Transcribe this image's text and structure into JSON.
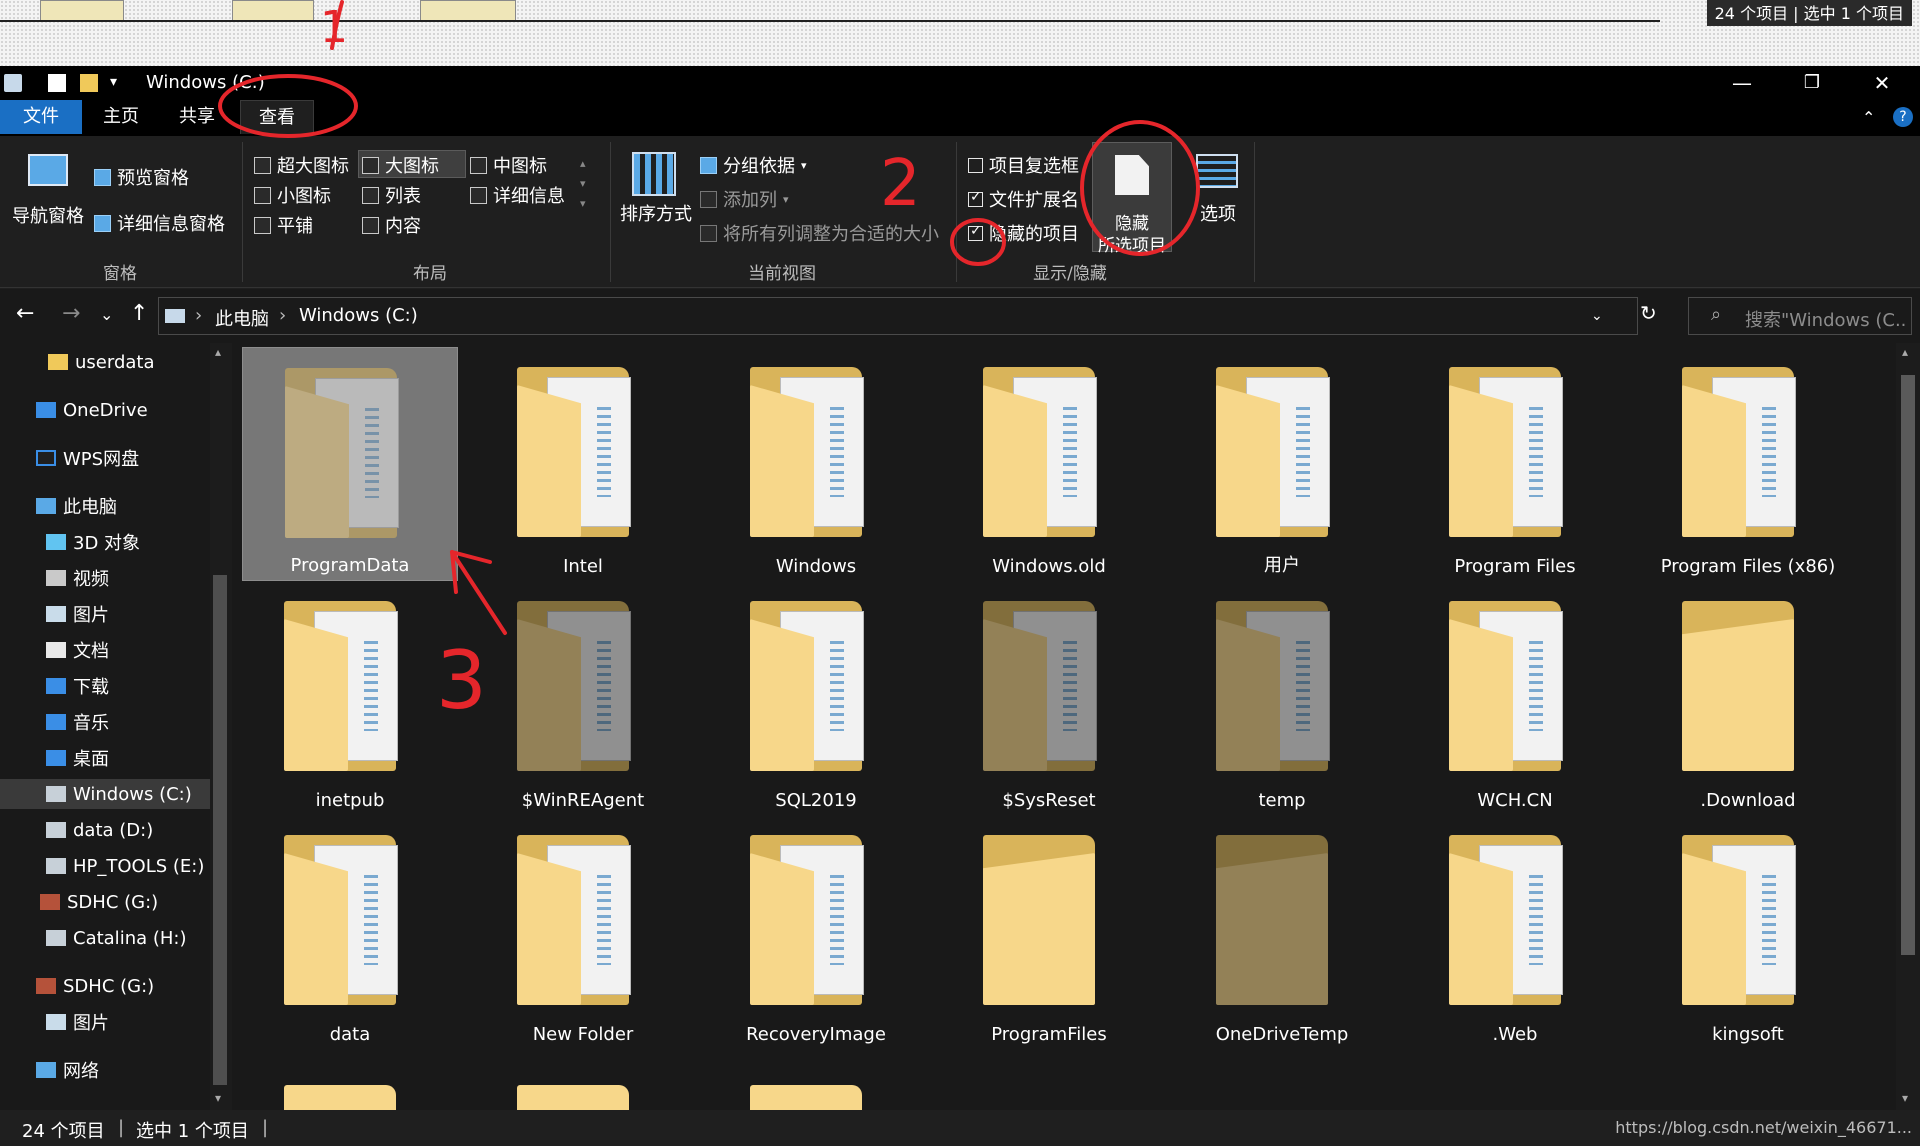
{
  "topstrip": {
    "status_ghost": "24 个项目 | 选中 1 个项目"
  },
  "titlebar": {
    "title": "Windows (C:)",
    "minimize": "—",
    "restore": "❐",
    "close": "✕"
  },
  "tabs": [
    {
      "label": "文件"
    },
    {
      "label": "主页"
    },
    {
      "label": "共享"
    },
    {
      "label": "查看"
    }
  ],
  "ribbon": {
    "pane": {
      "nav_pane": "导航窗格",
      "preview_pane": "预览窗格",
      "details_pane": "详细信息窗格",
      "group_label": "窗格"
    },
    "layout": {
      "extra_large": "超大图标",
      "large": "大图标",
      "medium": "中图标",
      "small": "小图标",
      "list": "列表",
      "details": "详细信息",
      "tiles": "平铺",
      "content": "内容",
      "group_label": "布局"
    },
    "current_view": {
      "sort_by": "排序方式",
      "group_by": "分组依据",
      "add_column": "添加列",
      "size_all_columns": "将所有列调整为合适的大小",
      "group_label": "当前视图"
    },
    "show_hide": {
      "item_checkboxes": "项目复选框",
      "item_checkboxes_checked": false,
      "file_extensions": "文件扩展名",
      "file_extensions_checked": true,
      "hidden_items": "隐藏的项目",
      "hidden_items_checked": true,
      "hide_selected_line1": "隐藏",
      "hide_selected_line2": "所选项目",
      "group_label": "显示/隐藏"
    },
    "options": "选项"
  },
  "address": {
    "crumbs": [
      "此电脑",
      "Windows (C:)"
    ],
    "search_placeholder": "搜索\"Windows (C..."
  },
  "navpane": {
    "items": [
      {
        "label": "userdata",
        "icon": "folder-icon"
      },
      {
        "label": "OneDrive",
        "icon": "cloud-icon"
      },
      {
        "label": "WPS网盘",
        "icon": "cloud-outline-icon"
      },
      {
        "label": "此电脑",
        "icon": "computer-icon"
      },
      {
        "label": "3D 对象",
        "icon": "cube-icon"
      },
      {
        "label": "视频",
        "icon": "video-icon"
      },
      {
        "label": "图片",
        "icon": "picture-icon"
      },
      {
        "label": "文档",
        "icon": "document-icon"
      },
      {
        "label": "下载",
        "icon": "download-icon"
      },
      {
        "label": "音乐",
        "icon": "music-icon"
      },
      {
        "label": "桌面",
        "icon": "desktop-icon"
      },
      {
        "label": "Windows (C:)",
        "icon": "drive-icon"
      },
      {
        "label": "data (D:)",
        "icon": "drive-icon"
      },
      {
        "label": "HP_TOOLS (E:)",
        "icon": "drive-icon"
      },
      {
        "label": "SDHC (G:)",
        "icon": "sd-card-icon"
      },
      {
        "label": "Catalina (H:)",
        "icon": "drive-icon"
      },
      {
        "label": "SDHC (G:)",
        "icon": "sd-card-icon"
      },
      {
        "label": "图片",
        "icon": "picture-icon"
      },
      {
        "label": "网络",
        "icon": "network-icon"
      }
    ]
  },
  "files": [
    {
      "name": "ProgramData",
      "hidden": true,
      "selected": true
    },
    {
      "name": "Intel"
    },
    {
      "name": "Windows"
    },
    {
      "name": "Windows.old"
    },
    {
      "name": "用户"
    },
    {
      "name": "Program Files"
    },
    {
      "name": "Program Files (x86)"
    },
    {
      "name": "inetpub"
    },
    {
      "name": "$WinREAgent",
      "hidden": true
    },
    {
      "name": "SQL2019"
    },
    {
      "name": "$SysReset",
      "hidden": true
    },
    {
      "name": "temp",
      "hidden": true
    },
    {
      "name": "WCH.CN"
    },
    {
      "name": ".Download"
    },
    {
      "name": "data"
    },
    {
      "name": "New Folder"
    },
    {
      "name": "RecoveryImage"
    },
    {
      "name": "ProgramFiles"
    },
    {
      "name": "OneDriveTemp",
      "hidden": true
    },
    {
      "name": ".Web"
    },
    {
      "name": "kingsoft"
    }
  ],
  "statusbar": {
    "count": "24 个项目",
    "selected": "选中 1 个项目",
    "watermark": "https://blog.csdn.net/weixin_46671..."
  },
  "annotations": {
    "step1": "1",
    "step2": "2",
    "step3": "3"
  },
  "colors": {
    "file_tab": "#1a6fc4",
    "annotation": "#e5262b",
    "folder": "#f7d78a"
  }
}
